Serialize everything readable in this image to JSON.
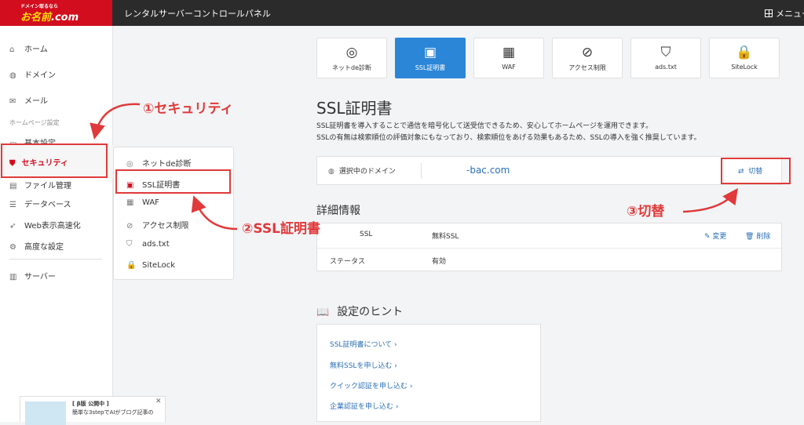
{
  "app": {
    "logo_small": "ドメイン取るなら",
    "logo_main": "お名前",
    "logo_dot": ".com",
    "panel_title": "レンタルサーバーコントロールパネル",
    "menu_label": "メニュー"
  },
  "sidebar": {
    "items": [
      {
        "label": "ホーム",
        "icon": "home-icon"
      },
      {
        "label": "ドメイン",
        "icon": "globe-icon"
      },
      {
        "label": "メール",
        "icon": "mail-icon"
      }
    ],
    "section_label": "ホームページ設定",
    "basic": "基本設定",
    "security": "セキュリティ",
    "file": "ファイル管理",
    "database": "データベース",
    "web_speed": "Web表示高速化",
    "advanced": "高度な設定",
    "server": "サーバー"
  },
  "submenu": {
    "items": [
      "ネットde診断",
      "SSL証明書",
      "WAF",
      "アクセス制限",
      "ads.txt",
      "SiteLock"
    ]
  },
  "tabs": [
    {
      "label": "ネットde診断",
      "icon": "globe-search-icon",
      "active": false
    },
    {
      "label": "SSL証明書",
      "icon": "certificate-icon",
      "active": true
    },
    {
      "label": "WAF",
      "icon": "firewall-icon",
      "active": false
    },
    {
      "label": "アクセス制限",
      "icon": "prohibited-icon",
      "active": false
    },
    {
      "label": "ads.txt",
      "icon": "ad-shield-icon",
      "active": false
    },
    {
      "label": "SiteLock",
      "icon": "lock-check-icon",
      "active": false
    }
  ],
  "main": {
    "title": "SSL証明書",
    "desc1": "SSL証明書を導入することで通信を暗号化して送受信できるため、安心してホームページを運用できます。",
    "desc2": "SSLの有無は検索順位の評価対象にもなっており、検索順位をあげる効果もあるため、SSLの導入を強く推奨しています。",
    "domain_label": "選択中のドメイン",
    "domain_value": "-bac.com",
    "switch_label": "切替",
    "details_title": "詳細情報",
    "ssl_key": "SSL",
    "ssl_value": "無料SSL",
    "edit_label": "変更",
    "delete_label": "削除",
    "status_key": "ステータス",
    "status_value": "有効"
  },
  "hints": {
    "title": "設定のヒント",
    "links": [
      "SSL証明書について ›",
      "無料SSLを申し込む ›",
      "クイック認証を申し込む ›",
      "企業認証を申し込む ›"
    ]
  },
  "annotations": {
    "step1": "①セキュリティ",
    "step2": "②SSL証明書",
    "step3": "③切替",
    "color": "#e03a3a"
  },
  "promo": {
    "badge": "[ β版 公開中 ]",
    "text": "簡単な3stepでAIがブログ記事の"
  }
}
